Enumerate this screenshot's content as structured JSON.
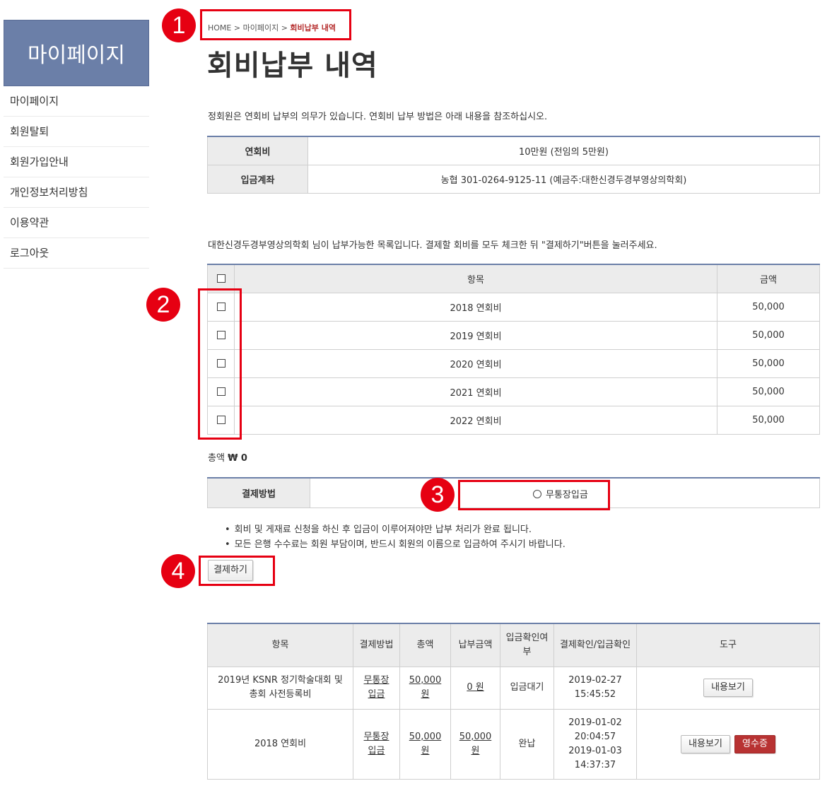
{
  "sidebar": {
    "title": "마이페이지",
    "items": [
      "마이페이지",
      "회원탈퇴",
      "회원가입안내",
      "개인정보처리방침",
      "이용약관",
      "로그아웃"
    ]
  },
  "breadcrumb": {
    "home": "HOME",
    "sep": ">",
    "parent": "마이페이지",
    "current": "회비납부 내역"
  },
  "page_title": "회비납부 내역",
  "intro": "정회원은 연회비 납부의 의무가 있습니다. 연회비 납부 방법은 아래 내용을 참조하십시오.",
  "info": {
    "fee_label": "연회비",
    "fee_value": "10만원 (전임의 5만원)",
    "account_label": "입금계좌",
    "account_value": "농협 301-0264-9125-11 (예금주:대한신경두경부영상의학회)"
  },
  "instruction": "대한신경두경부영상의학회 님이 납부가능한 목록입니다. 결제할 회비를 모두 체크한 뒤 \"결제하기\"버튼을 눌러주세요.",
  "fees": {
    "headers": {
      "item": "항목",
      "amount": "금액"
    },
    "rows": [
      {
        "item": "2018 연회비",
        "amount": "50,000"
      },
      {
        "item": "2019 연회비",
        "amount": "50,000"
      },
      {
        "item": "2020 연회비",
        "amount": "50,000"
      },
      {
        "item": "2021 연회비",
        "amount": "50,000"
      },
      {
        "item": "2022 연회비",
        "amount": "50,000"
      }
    ]
  },
  "total": {
    "label": "총액",
    "value": "₩ 0"
  },
  "payment": {
    "label": "결제방법",
    "option": "무통장입금"
  },
  "notes": [
    "회비 및 게재료 신청을 하신 후 입금이 이루어져야만 납부 처리가 완료 됩니다.",
    "모든 은행 수수료는 회원 부담이며, 반드시 회원의 이름으로 입금하여 주시기 바랍니다."
  ],
  "pay_button": "결제하기",
  "history": {
    "headers": {
      "item": "항목",
      "method": "결제방법",
      "total": "총액",
      "paid": "납부금액",
      "deposit": "입금확인여부",
      "confirm": "결제확인/입금확인",
      "tools": "도구"
    },
    "rows": [
      {
        "item_l1": "2019년 KSNR 정기학술대회 및",
        "item_l2": "총회 사전등록비",
        "method_l1": "무통장",
        "method_l2": "입금",
        "total_l1": "50,000",
        "total_l2": "원",
        "paid": "0 원",
        "deposit": "입금대기",
        "confirm_l1": "2019-02-27",
        "confirm_l2": "15:45:52",
        "view": "내용보기"
      },
      {
        "item": "2018 연회비",
        "method_l1": "무통장",
        "method_l2": "입금",
        "total_l1": "50,000",
        "total_l2": "원",
        "paid_l1": "50,000",
        "paid_l2": "원",
        "deposit": "완납",
        "confirm_l1": "2019-01-02",
        "confirm_l2": "20:04:57",
        "confirm_l3": "2019-01-03",
        "confirm_l4": "14:37:37",
        "view": "내용보기",
        "receipt": "영수증"
      }
    ]
  },
  "annotations": [
    "1",
    "2",
    "3",
    "4"
  ],
  "colors": {
    "accent": "#6b7fa8",
    "annotation": "#e60012",
    "receipt": "#b83232",
    "crumb_current": "#b42a2a"
  }
}
